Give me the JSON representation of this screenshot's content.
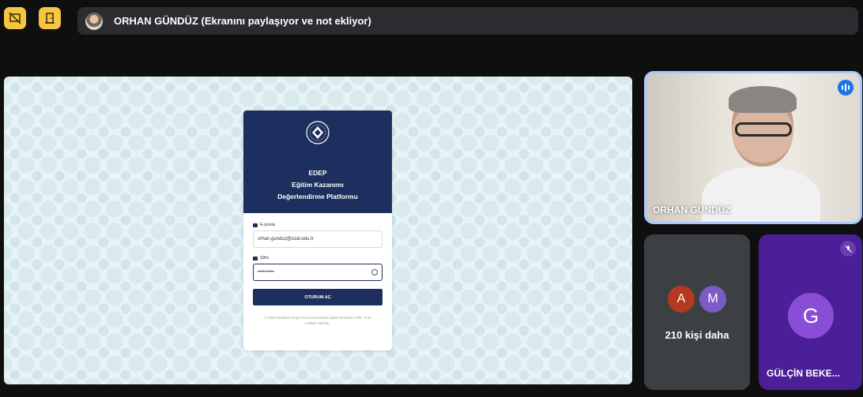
{
  "banner": {
    "presenter_text": "ORHAN GÜNDÜZ (Ekranını paylaşıyor ve not ekliyor)"
  },
  "login": {
    "app_name": "EDEP",
    "subtitle_line1": "Eğitim Kazanımı",
    "subtitle_line2": "Değerlendirme Platformu",
    "email_label": "E-posta",
    "email_value": "orhan.gunduz@ozal.edu.tr",
    "password_label": "Şifre",
    "password_value": "••••••••••",
    "submit_label": "OTURUM AÇ",
    "footer": "© 2025 Malatya Turgut Özal Üniversitesi Dijital Dönüşüm Ofisi. Tüm Hakları Saklıdır."
  },
  "participants": {
    "speaker_name": "ORHAN GÜNDÜZ",
    "avatar_a": "A",
    "avatar_m": "M",
    "more_text": "210 kişi daha",
    "g_initial": "G",
    "g_name": "GÜLÇİN BEKE..."
  },
  "colors": {
    "accent_yellow": "#f6c542",
    "navy": "#1d2f5e",
    "speaker_border": "#a8c7fa",
    "purple_tile": "#4a1f97"
  },
  "icons": [
    "presentation-off-icon",
    "door-icon",
    "mail-icon",
    "lock-icon",
    "eye-icon",
    "speaking-icon",
    "mic-off-icon"
  ]
}
